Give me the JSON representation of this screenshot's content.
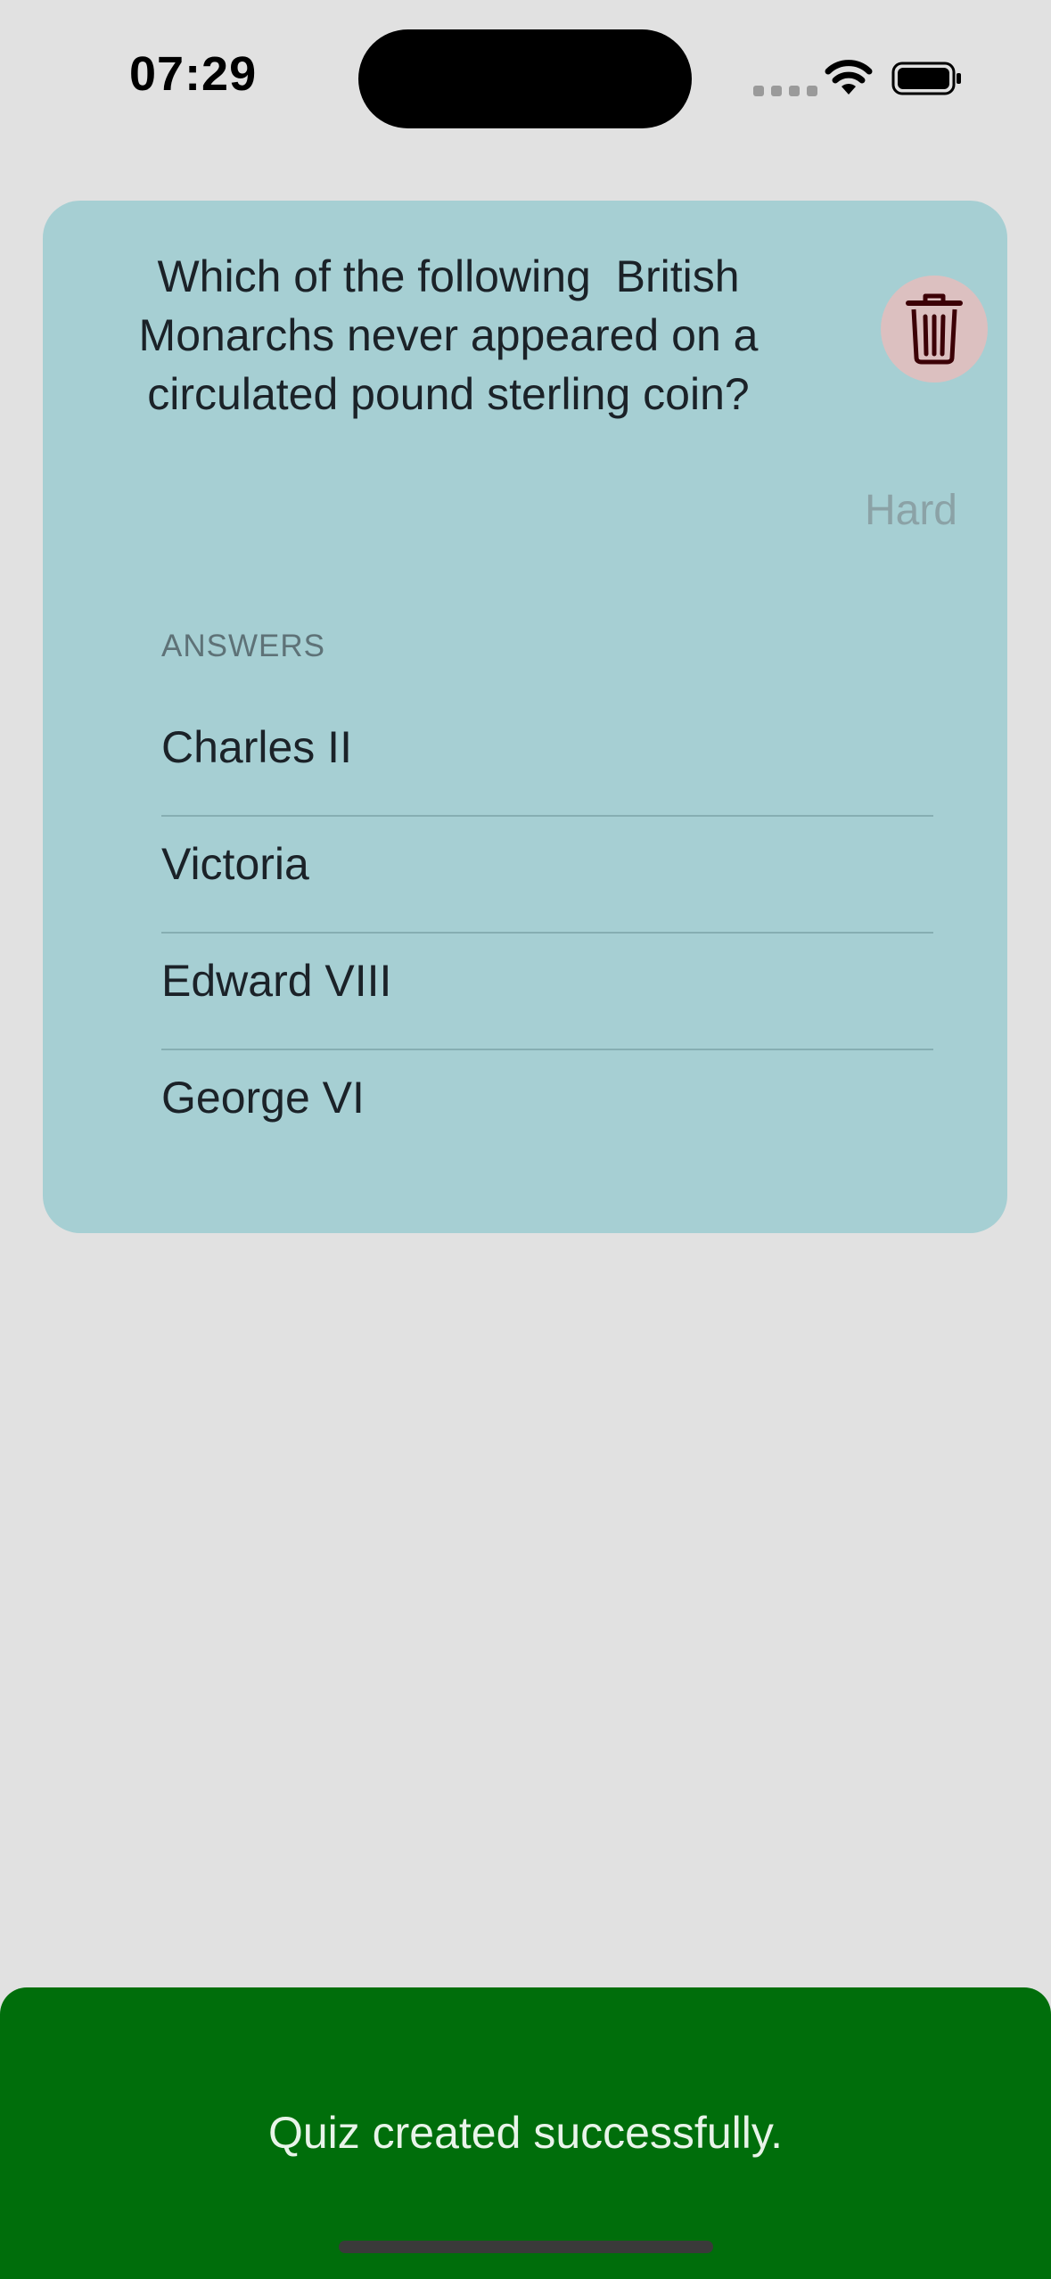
{
  "status_bar": {
    "time": "07:29",
    "icons": [
      "cellular-signal-icon",
      "wifi-icon",
      "battery-icon"
    ]
  },
  "quiz_card": {
    "question": "Which of the following  British\nMonarchs never appeared on a\ncirculated pound sterling coin?",
    "difficulty": "Hard",
    "delete_icon": "trash-icon",
    "answers_header": "ANSWERS",
    "answers": [
      "Charles II",
      "Victoria",
      "Edward VIII",
      "George VI"
    ],
    "background_color": "#a6cfd3"
  },
  "toast": {
    "message": "Quiz created successfully.",
    "background_color": "#006e0b"
  },
  "colors": {
    "page_background": "#e1e1e1",
    "delete_button_background": "#dcc0c0",
    "delete_icon_color": "#3c0006"
  }
}
